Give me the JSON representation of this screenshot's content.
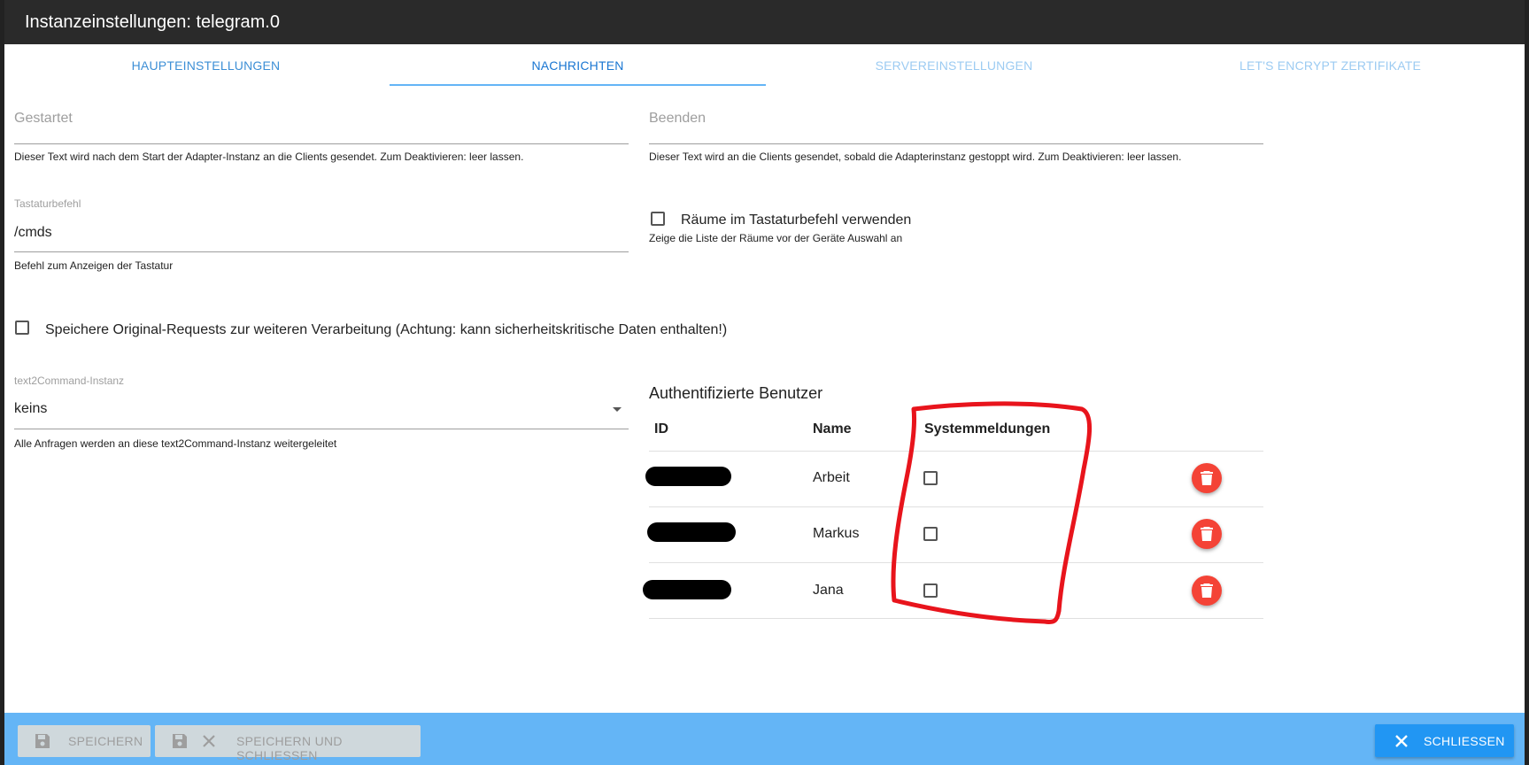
{
  "window": {
    "title": "Instanzeinstellungen: telegram.0"
  },
  "tabs": [
    {
      "label": "HAUPTEINSTELLUNGEN",
      "color": "#1e88e5"
    },
    {
      "label": "NACHRICHTEN",
      "color": "#1e88e5",
      "active": true
    },
    {
      "label": "SERVEREINSTELLUNGEN",
      "color": "#90caf9"
    },
    {
      "label": "LET'S ENCRYPT ZERTIFIKATE",
      "color": "#90caf9"
    }
  ],
  "fields": {
    "gestartet": {
      "label": "Gestartet",
      "value": "",
      "helper": "Dieser Text wird nach dem Start der Adapter-Instanz an die Clients gesendet. Zum Deaktivieren: leer lassen."
    },
    "beenden": {
      "label": "Beenden",
      "value": "",
      "helper": "Dieser Text wird an die Clients gesendet, sobald die Adapterinstanz gestoppt wird. Zum Deaktivieren: leer lassen."
    },
    "tastaturbefehl": {
      "label": "Tastaturbefehl",
      "value": "/cmds",
      "helper": "Befehl zum Anzeigen der Tastatur"
    },
    "raeume": {
      "label": "Räume im Tastaturbefehl verwenden",
      "helper": "Zeige die Liste der Räume vor der Geräte Auswahl an",
      "checked": false
    },
    "original_requests": {
      "label": "Speichere Original-Requests zur weiteren Verarbeitung (Achtung: kann sicherheitskritische Daten enthalten!)",
      "checked": false
    },
    "text2command": {
      "label": "text2Command-Instanz",
      "value": "keins",
      "helper": "Alle Anfragen werden an diese text2Command-Instanz weitergeleitet"
    }
  },
  "users": {
    "title": "Authentifizierte Benutzer",
    "columns": [
      "ID",
      "Name",
      "Systemmeldungen"
    ],
    "rows": [
      {
        "name": "Arbeit",
        "system": false
      },
      {
        "name": "Markus",
        "system": false
      },
      {
        "name": "Jana",
        "system": false
      }
    ]
  },
  "footer": {
    "save_label": "SPEICHERN",
    "save_close_label": "SPEICHERN UND SCHLIESSEN",
    "close_label": "SCHLIESSEN"
  },
  "colors": {
    "accent": "#2196f3",
    "footer_bg": "#64b5f6",
    "delete": "#f44336",
    "annotation": "#e8141c"
  }
}
